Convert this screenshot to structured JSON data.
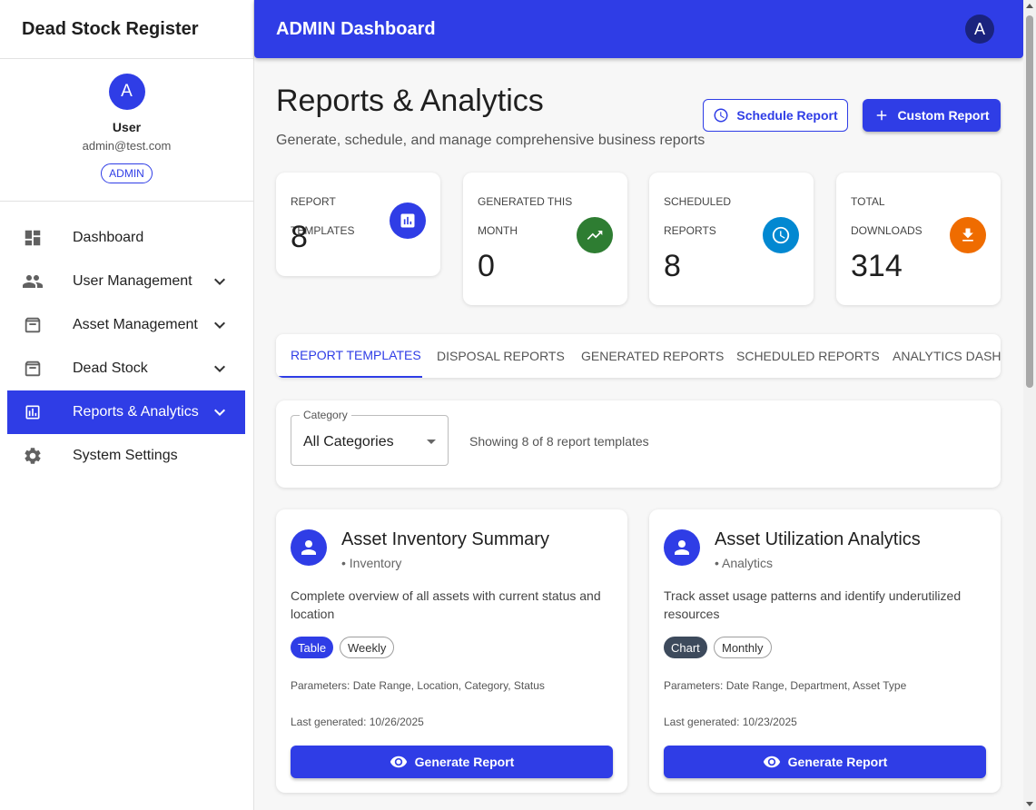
{
  "app": {
    "brand": "Dead Stock Register",
    "header_title": "ADMIN Dashboard",
    "header_avatar": "A"
  },
  "profile": {
    "avatar": "A",
    "name": "User",
    "email": "admin@test.com",
    "role": "ADMIN"
  },
  "sidebar": {
    "items": [
      {
        "label": "Dashboard",
        "icon": "dashboard-icon"
      },
      {
        "label": "User Management",
        "icon": "people-icon"
      },
      {
        "label": "Asset Management",
        "icon": "archive-icon"
      },
      {
        "label": "Dead Stock",
        "icon": "archive-icon"
      },
      {
        "label": "Reports & Analytics",
        "icon": "assessment-icon",
        "active": true
      },
      {
        "label": "System Settings",
        "icon": "gear-icon"
      }
    ]
  },
  "page": {
    "title": "Reports & Analytics",
    "subtitle": "Generate, schedule, and manage comprehensive business reports",
    "schedule_button": "Schedule Report",
    "custom_button": "Custom Report"
  },
  "stats": [
    {
      "label": "REPORT TEMPLATES",
      "value": "8",
      "color": "#2f3de6",
      "icon": "assessment-icon"
    },
    {
      "label": "GENERATED THIS MONTH",
      "value": "0",
      "color": "#2e7d32",
      "icon": "trending-up-icon"
    },
    {
      "label": "SCHEDULED REPORTS",
      "value": "8",
      "color": "#0288d1",
      "icon": "clock-icon"
    },
    {
      "label": "TOTAL DOWNLOADS",
      "value": "314",
      "color": "#ef6c00",
      "icon": "download-icon"
    }
  ],
  "tabs": [
    "REPORT TEMPLATES",
    "DISPOSAL REPORTS",
    "GENERATED REPORTS",
    "SCHEDULED REPORTS",
    "ANALYTICS DASHBOARD"
  ],
  "filter": {
    "legend": "Category",
    "value": "All Categories",
    "count_text": "Showing 8 of 8 report templates"
  },
  "templates": [
    {
      "title": "Asset Inventory Summary",
      "category": "• Inventory",
      "description": "Complete overview of all assets with current status and location",
      "chips": [
        "Table",
        "Weekly"
      ],
      "chip_color": "#2f3de6",
      "params": "Parameters: Date Range, Location, Category, Status",
      "last": "Last generated: 10/26/2025",
      "button": "Generate Report"
    },
    {
      "title": "Asset Utilization Analytics",
      "category": "• Analytics",
      "description": "Track asset usage patterns and identify underutilized resources",
      "chips": [
        "Chart",
        "Monthly"
      ],
      "chip_color": "#3d4a5c",
      "params": "Parameters: Date Range, Department, Asset Type",
      "last": "Last generated: 10/23/2025",
      "button": "Generate Report"
    }
  ]
}
